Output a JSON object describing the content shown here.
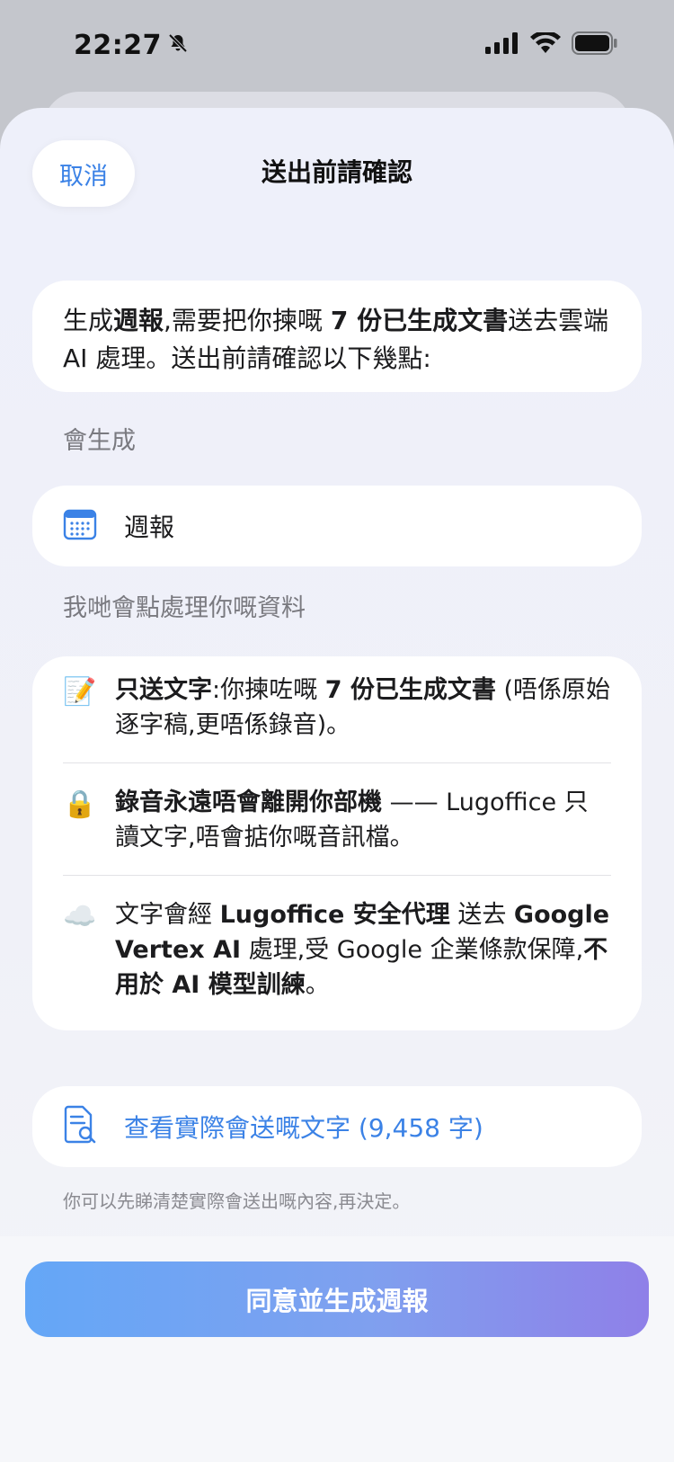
{
  "status_bar": {
    "time": "22:27"
  },
  "header": {
    "cancel_label": "取消",
    "title": "送出前請確認"
  },
  "intro": {
    "t1": "生成",
    "t2": "週報",
    "t3": ",需要把你揀嘅 ",
    "t4": "7 份已生成文書",
    "t5": "送去雲端 AI 處理。送出前請確認以下幾點:"
  },
  "generate_section": {
    "label": "會生成",
    "item_label": "週報",
    "item_icon": "calendar-icon"
  },
  "process_section": {
    "label": "我哋會點處理你嘅資料",
    "row1": {
      "emoji": "📝",
      "b1": "只送文字",
      "t1": ":你揀咗嘅 ",
      "b2": "7 份已生成文書",
      "t2": " (唔係原始逐字稿,更唔係錄音)。"
    },
    "row2": {
      "emoji": "🔒",
      "b1": "錄音永遠唔會離開你部機",
      "t1": " —— Lugoffice 只讀文字,唔會掂你嘅音訊檔。"
    },
    "row3": {
      "emoji": "☁️",
      "t1": "文字會經 ",
      "b1": "Lugoffice 安全代理",
      "t2": " 送去 ",
      "b2": "Google Vertex AI",
      "t3": " 處理,受 Google 企業條款保障,",
      "b3": "不用於 AI 模型訓練",
      "t4": "。"
    }
  },
  "preview": {
    "label": "查看實際會送嘅文字 (9,458 字)",
    "hint": "你可以先睇清楚實際會送出嘅內容,再決定。"
  },
  "cta": {
    "label": "同意並生成週報"
  },
  "colors": {
    "accent": "#3b82e6",
    "cta_start": "#64a7f7",
    "cta_end": "#8f80e8"
  }
}
